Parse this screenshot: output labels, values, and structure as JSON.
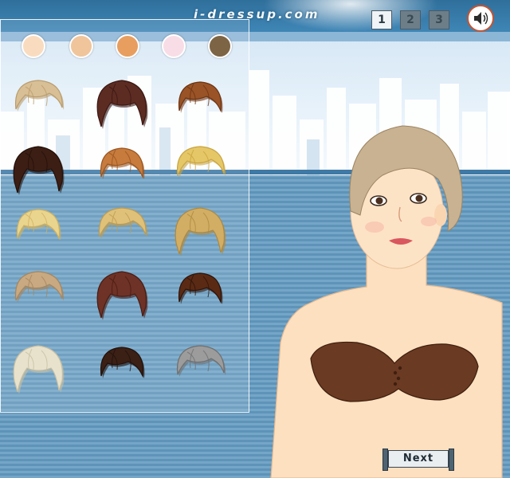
{
  "header": {
    "site_name": "i-dressup.com"
  },
  "levels": [
    {
      "label": "1",
      "active": true
    },
    {
      "label": "2",
      "active": false
    },
    {
      "label": "3",
      "active": false
    }
  ],
  "sound": {
    "icon": "speaker-icon"
  },
  "skin_tones": [
    "#f9dcbf",
    "#f0c59b",
    "#e79e5f",
    "#f9dde6",
    "#7c6445"
  ],
  "hairstyles": [
    {
      "id": "pixie-blonde",
      "color": "#d9bf95",
      "shade": "#b99c6d"
    },
    {
      "id": "long-side-dark-auburn",
      "color": "#5c2c22",
      "shade": "#3a1712"
    },
    {
      "id": "bob-copper",
      "color": "#9a5326",
      "shade": "#6c3414"
    },
    {
      "id": "bob-dark-brown",
      "color": "#3c1e14",
      "shade": "#22100a"
    },
    {
      "id": "short-ginger",
      "color": "#c77b3c",
      "shade": "#9a5520"
    },
    {
      "id": "short-golden",
      "color": "#e5c767",
      "shade": "#c9a440"
    },
    {
      "id": "swept-light-blonde",
      "color": "#ead58f",
      "shade": "#cfb261"
    },
    {
      "id": "layered-honey",
      "color": "#dfc17a",
      "shade": "#bd9c52"
    },
    {
      "id": "tousled-sandy",
      "color": "#d2ae64",
      "shade": "#ad8940"
    },
    {
      "id": "pixie-ash",
      "color": "#c9a982",
      "shade": "#a6865e"
    },
    {
      "id": "shag-mahogany",
      "color": "#6e3226",
      "shade": "#4a1c12"
    },
    {
      "id": "shag-chestnut",
      "color": "#5a2a14",
      "shade": "#2e140a"
    },
    {
      "id": "messy-platinum",
      "color": "#e8e2cd",
      "shade": "#c7bfa3"
    },
    {
      "id": "messy-espresso",
      "color": "#3b2016",
      "shade": "#22110a"
    },
    {
      "id": "spiky-silver",
      "color": "#9c9c9c",
      "shade": "#6f6f6f"
    }
  ],
  "model": {
    "hair_color": "#c9b291",
    "top_color": "#6b3a22"
  },
  "next_button": {
    "label": "Next"
  }
}
